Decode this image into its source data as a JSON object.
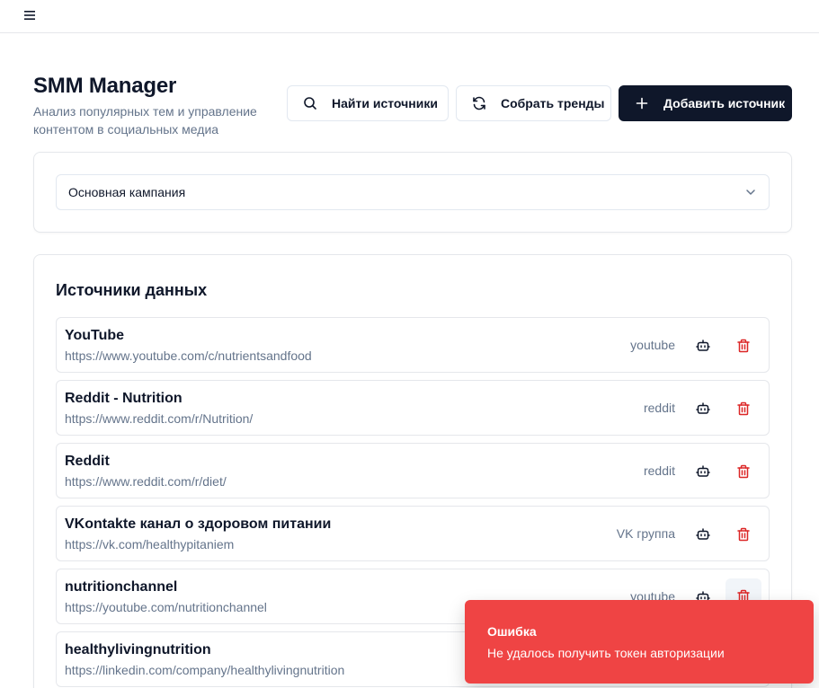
{
  "app": {
    "title": "SMM Manager",
    "subtitle": "Анализ популярных тем и управление контентом в социальных медиа"
  },
  "actions": {
    "find_label": "Найти источники",
    "trends_label": "Собрать тренды",
    "add_label": "Добавить источник"
  },
  "campaign": {
    "selected": "Основная кампания"
  },
  "sources": {
    "title": "Источники данных",
    "items": [
      {
        "name": "YouTube",
        "url": "https://www.youtube.com/c/nutrientsandfood",
        "type": "youtube"
      },
      {
        "name": "Reddit - Nutrition",
        "url": "https://www.reddit.com/r/Nutrition/",
        "type": "reddit"
      },
      {
        "name": "Reddit",
        "url": "https://www.reddit.com/r/diet/",
        "type": "reddit"
      },
      {
        "name": "VKontakte канал о здоровом питании",
        "url": "https://vk.com/healthypitaniem",
        "type": "VK группа"
      },
      {
        "name": "nutritionchannel",
        "url": "https://youtube.com/nutritionchannel",
        "type": "youtube"
      },
      {
        "name": "healthylivingnutrition",
        "url": "https://linkedin.com/company/healthylivingnutrition",
        "type": ""
      }
    ]
  },
  "toast": {
    "title": "Ошибка",
    "message": "Не удалось получить токен авторизации"
  },
  "colors": {
    "primary": "#0f172a",
    "muted": "#64748b",
    "border": "#e5e7eb",
    "danger": "#ef4444",
    "delete_icon": "#dc2626"
  },
  "icons": {
    "menu": "menu-icon",
    "find": "search-icon",
    "trends": "refresh-icon",
    "add": "plus-icon",
    "select": "chevron-down-icon",
    "source_action": "bot-icon",
    "source_delete": "trash-icon"
  }
}
